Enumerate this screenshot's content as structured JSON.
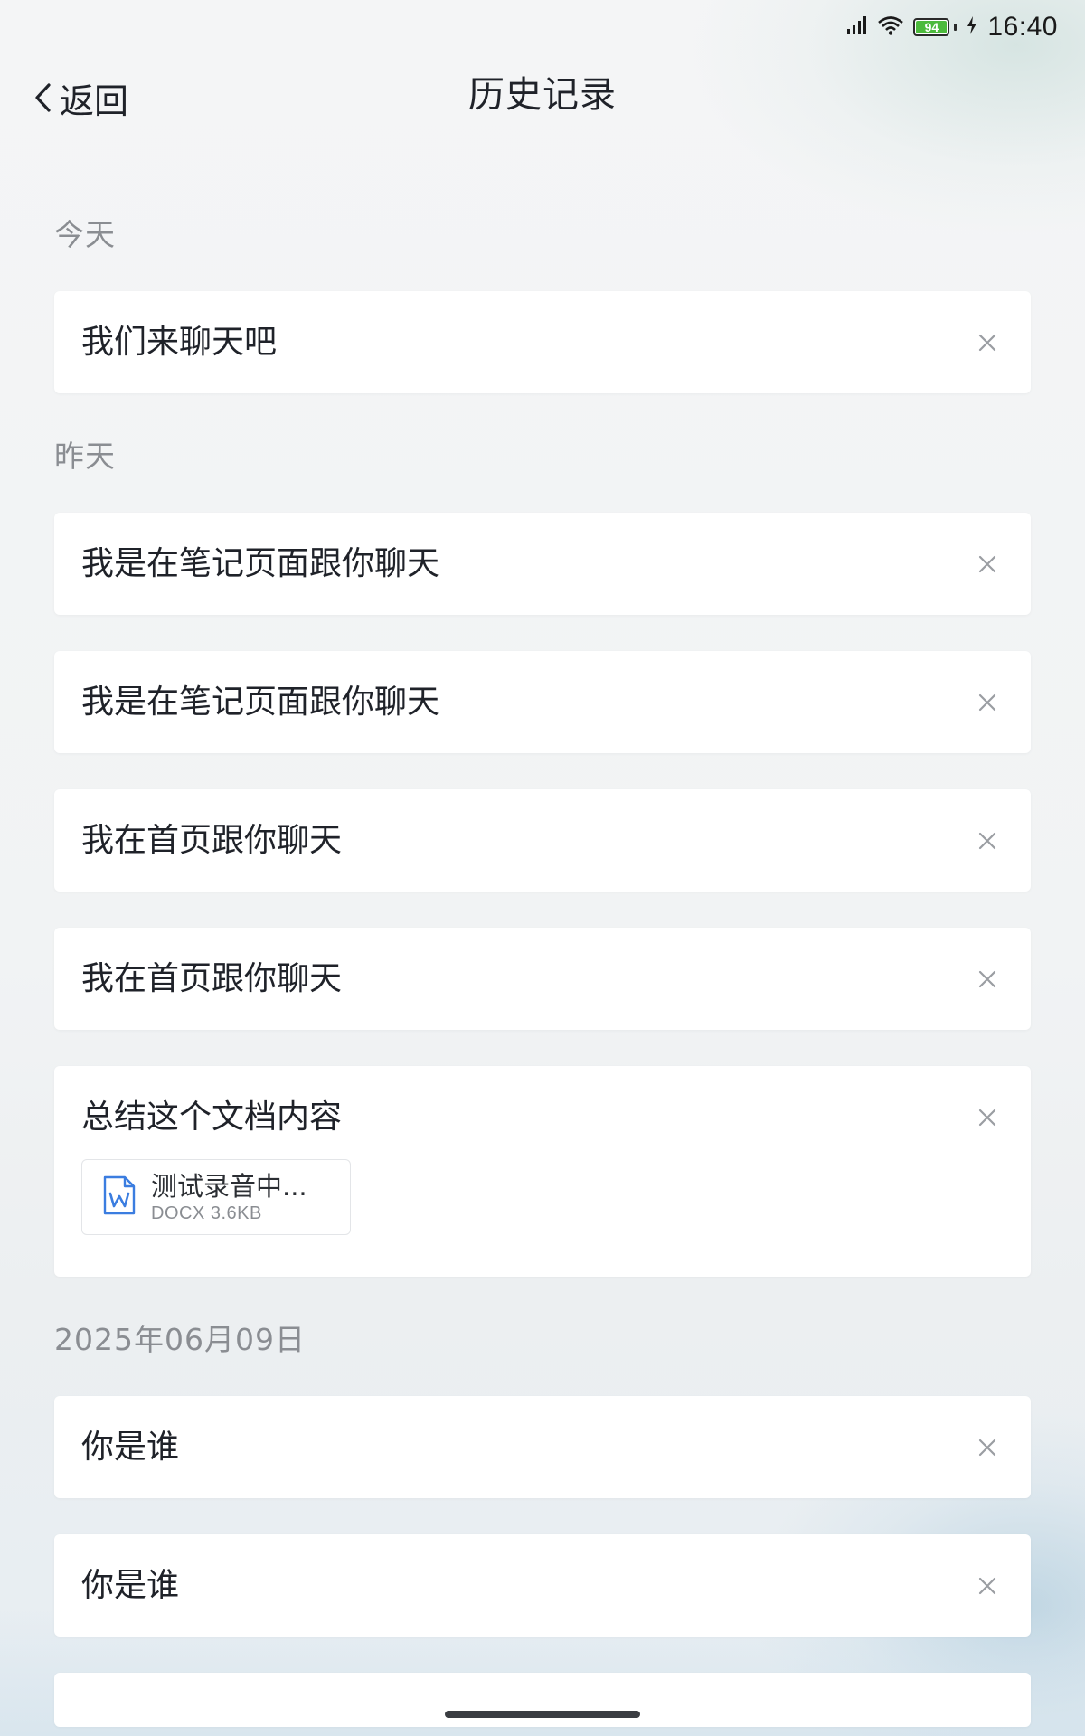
{
  "status_bar": {
    "time": "16:40",
    "battery_level": "94",
    "icons": [
      "signal-icon",
      "wifi-icon",
      "battery-icon",
      "charging-icon"
    ]
  },
  "header": {
    "back_label": "返回",
    "title": "历史记录"
  },
  "sections": [
    {
      "label": "今天",
      "items": [
        {
          "title": "我们来聊天吧"
        }
      ]
    },
    {
      "label": "昨天",
      "items": [
        {
          "title": "我是在笔记页面跟你聊天"
        },
        {
          "title": "我是在笔记页面跟你聊天"
        },
        {
          "title": "我在首页跟你聊天"
        },
        {
          "title": "我在首页跟你聊天"
        },
        {
          "title": "总结这个文档内容",
          "attachment": {
            "name": "测试录音中...",
            "meta": "DOCX 3.6KB",
            "icon": "word-document-icon"
          }
        }
      ]
    },
    {
      "label": "2025年06月09日",
      "items": [
        {
          "title": "你是谁"
        },
        {
          "title": "你是谁"
        }
      ]
    }
  ],
  "colors": {
    "accent_doc_blue": "#3b7de0",
    "battery_green": "#4cba3c",
    "section_label_gray": "#8a8d92",
    "text_primary": "#1f2229"
  }
}
